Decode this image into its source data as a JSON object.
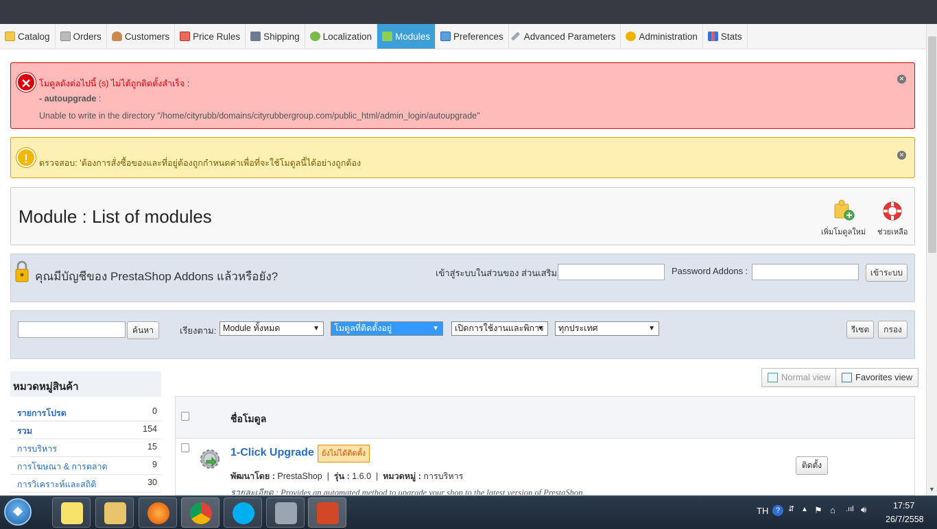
{
  "colors": {
    "accent": "#3d9fd8",
    "error_bg": "#ffbaba",
    "warn_bg": "#feefb3",
    "link": "#2a6ebb"
  },
  "tabs": [
    {
      "label": "Catalog",
      "icon": "folder-icon"
    },
    {
      "label": "Orders",
      "icon": "cart-icon"
    },
    {
      "label": "Customers",
      "icon": "user-icon"
    },
    {
      "label": "Price Rules",
      "icon": "price-tag-icon"
    },
    {
      "label": "Shipping",
      "icon": "truck-icon"
    },
    {
      "label": "Localization",
      "icon": "globe-icon"
    },
    {
      "label": "Modules",
      "icon": "puzzle-icon",
      "active": true
    },
    {
      "label": "Preferences",
      "icon": "preferences-icon"
    },
    {
      "label": "Advanced Parameters",
      "icon": "wrench-icon"
    },
    {
      "label": "Administration",
      "icon": "key-icon"
    },
    {
      "label": "Stats",
      "icon": "bar-chart-icon"
    }
  ],
  "error_alert": {
    "line1": "โมดูลดังต่อไปนี้ (s) ไม่ได้ถูกติดตั้งสำเร็จ :",
    "module": "- autoupgrade",
    "module_suffix": " :",
    "message": "Unable to write in the directory \"/home/cityrubb/domains/cityrubbergroup.com/public_html/admin_login/autoupgrade\"",
    "icon": "error-x-icon"
  },
  "warning_alert": {
    "text": "ตรวจสอบ: 'ต้องการสั่งซื้อของและที่อยู่ต้องถูกกำหนดค่าเพื่อที่จะใช้โมดูลนี้ได้อย่างถูกต้อง",
    "icon": "warning-exclamation-icon"
  },
  "page": {
    "title": "Module : List of modules",
    "add_module_label": "เพิ่มโมดูลใหม่",
    "help_label": "ช่วยเหลือ"
  },
  "addons": {
    "question": "คุณมีบัญชีของ PrestaShop Addons แล้วหรือยัง?",
    "login_label": "เข้าสู่ระบบในส่วนของ ส่วนเสริม :",
    "password_label": "Password Addons :",
    "login_button": "เข้าระบบ"
  },
  "filter": {
    "search_button": "ค้นหา",
    "sort_label": "เรียงตาม:",
    "select1": "Module ทั้งหมด",
    "select2": "โมดูลที่ติดตั้งอยู่",
    "select3": "เปิดการใช้งานและพิการ",
    "select4": "ทุกประเทศ",
    "reset_button": "รีเซต",
    "filter_button": "กรอง"
  },
  "views": {
    "normal": "Normal view",
    "favorites": "Favorites view"
  },
  "categories": {
    "title": "หมวดหมู่สินค้า",
    "items": [
      {
        "name": "รายการโปรด",
        "count": "0"
      },
      {
        "name": "รวม",
        "count": "154"
      },
      {
        "name": "การบริหาร",
        "count": "15"
      },
      {
        "name": "การโฆษณา & การตลาด",
        "count": "9"
      },
      {
        "name": "การวิเคราะห์และสถิติ",
        "count": "30"
      }
    ]
  },
  "module_table": {
    "header": "ชื่อโมดูล",
    "rows": [
      {
        "name": "1-Click Upgrade",
        "badge": "ยังไม่ได้ติดตั้ง",
        "dev_label": "พัฒนาโดย :",
        "dev": "PrestaShop",
        "version_label": "รุ่น :",
        "version": "1.6.0",
        "category_label": "หมวดหมู่ :",
        "category": "การบริหาร",
        "desc": "รายละเอียด : Provides an automated method to upgrade your shop to the latest version of PrestaShop.",
        "install_button": "ติดตั้ง"
      }
    ]
  },
  "taskbar": {
    "language": "TH",
    "time": "17:57",
    "date": "26/7/2558",
    "apps": [
      "sticky-notes-icon",
      "file-explorer-icon",
      "firefox-icon",
      "chrome-icon",
      "skype-icon",
      "screen-capture-icon",
      "powerpoint-icon"
    ]
  }
}
